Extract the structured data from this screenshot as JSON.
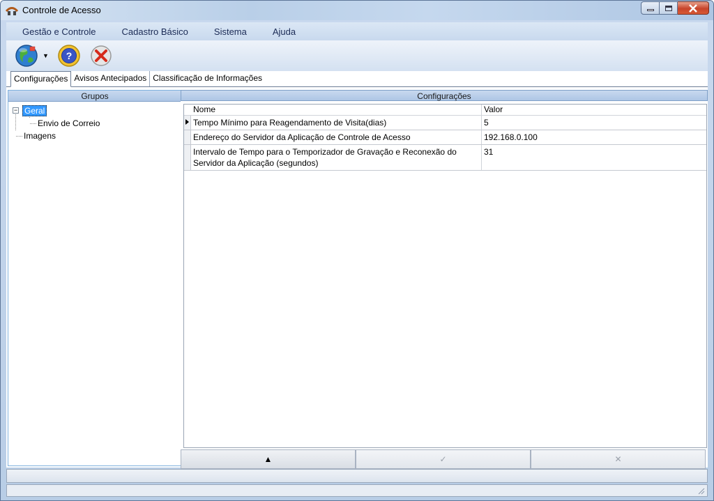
{
  "window": {
    "title": "Controle de Acesso",
    "icon": "app-logo-icon"
  },
  "menu": [
    "Gestão e Controle",
    "Cadastro Básico",
    "Sistema",
    "Ajuda"
  ],
  "toolbar": {
    "icons": [
      "globe-icon",
      "help-icon",
      "close-circle-icon"
    ]
  },
  "tabs": [
    "Configurações",
    "Avisos Antecipados",
    "Classificação de Informações"
  ],
  "active_tab": "Configurações",
  "left_panel": {
    "title": "Grupos",
    "tree": {
      "root": "Geral",
      "root_expander": "−",
      "child": "Envio de Correio",
      "sibling": "Imagens"
    }
  },
  "right_panel": {
    "title": "Configurações",
    "columns": [
      "Nome",
      "Valor"
    ],
    "rows": [
      {
        "name": "Tempo Mínimo para Reagendamento de Visita(dias)",
        "value": "5"
      },
      {
        "name": "Endereço do Servidor da Aplicação de Controle de Acesso",
        "value": "192.168.0.100"
      },
      {
        "name": "Intervalo de Tempo para o Temporizador de Gravação e Reconexão do Servidor da Aplicação (segundos)",
        "value": "31"
      }
    ],
    "buttons": [
      "▲",
      "✓",
      "✕"
    ]
  },
  "colors": {
    "selection": "#3399ff",
    "header_blue": "#aec6e5",
    "close_red": "#c7442a"
  }
}
